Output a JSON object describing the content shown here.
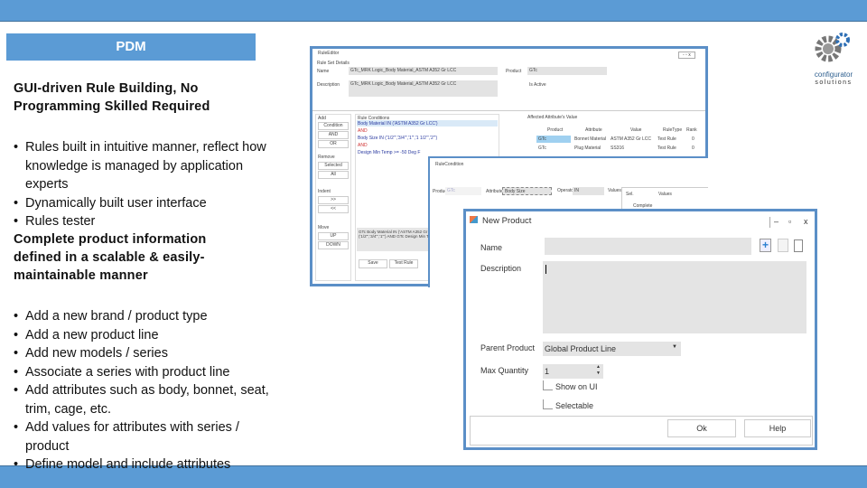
{
  "header": {
    "title": "PDM"
  },
  "section1": {
    "heading": "GUI-driven Rule Building, No Programming Skilled Required",
    "bullets": [
      "Rules built in intuitive manner, reflect how knowledge is managed by application experts",
      "Dynamically built user interface",
      "Rules tester"
    ]
  },
  "section2": {
    "heading": "Complete product information defined in a scalable & easily-maintainable manner",
    "bullets": [
      "Add a new brand / product type",
      "Add a new product line",
      "Add new models / series",
      "Associate a series with product line",
      "Add attributes such as body, bonnet, seat, trim, cage, etc.",
      "Add values for attributes with series / product",
      "Define model and include attributes"
    ]
  },
  "logo": {
    "line1": "configurator",
    "line2": "solutions"
  },
  "rule_window": {
    "title": "RuleEditor",
    "group": "Rule Set Details",
    "name_label": "Name",
    "name_value": "GTc_MRK Logic_Body Material_ASTM A352 Gr LCC",
    "desc_label": "Description",
    "desc_value": "GTc_MRK Logic_Body Material_ASTM A352 Gr LCC",
    "product_label": "Product",
    "product_value": "GTc",
    "active_label": "Is Active",
    "add_label": "Add",
    "add_buttons": [
      "Condition",
      "AND",
      "OR"
    ],
    "remove_label": "Remove",
    "remove_buttons": [
      "Selected",
      "All"
    ],
    "indent_label": "Indent",
    "indent_buttons": [
      ">>",
      "<<"
    ],
    "move_label": "Move",
    "move_buttons": [
      "UP",
      "DOWN"
    ],
    "conditions_label": "Rule Conditions",
    "conditions": [
      {
        "text": "Body Material IN ('ASTM A352 Gr LCC')",
        "op": false
      },
      {
        "text": "AND",
        "op": true
      },
      {
        "text": "Body Size IN ('1/2\"','3/4\"','1\"','1 1/2\"','2\"')",
        "op": false
      },
      {
        "text": "AND",
        "op": true
      },
      {
        "text": "Design Min Temp >= -50 Deg F",
        "op": false
      }
    ],
    "summary": "GTc Body Material IN ('ASTM A352 Gr LCC') AND Body Size IN ('1/2\"','3/4\"','1\"') AND GTc Design Min Temp",
    "bottom_buttons": [
      "Save",
      "Test Rule"
    ],
    "affected_label": "Affected Attribute's Value",
    "columns": [
      "Product",
      "Attribute",
      "Value",
      "RuleType",
      "Rank"
    ],
    "rows": [
      [
        "GTc",
        "Bonnet Material",
        "ASTM A352 Gr LCC",
        "Test Rule",
        "0"
      ],
      [
        "GTc",
        "Plug Material",
        "SS316",
        "Test Rule",
        "0"
      ]
    ]
  },
  "condition_window": {
    "title": "RuleCondition",
    "product_label": "Product",
    "product_value": "GTc",
    "attribute_label": "Attribute",
    "attribute_value": "Body Size",
    "operator_label": "Operator",
    "operator_value": "IN",
    "values_label": "Values",
    "col_sel": "Sel.",
    "col_values": "Values",
    "first_value": "Complete"
  },
  "new_product": {
    "title": "New Product",
    "name_label": "Name",
    "name_value": "",
    "desc_label": "Description",
    "desc_value": "",
    "parent_label": "Parent Product",
    "parent_value": "Global Product Line",
    "maxqty_label": "Max Quantity",
    "maxqty_value": "1",
    "show_ui_label": "Show on UI",
    "selectable_label": "Selectable",
    "ok_label": "Ok",
    "help_label": "Help"
  }
}
